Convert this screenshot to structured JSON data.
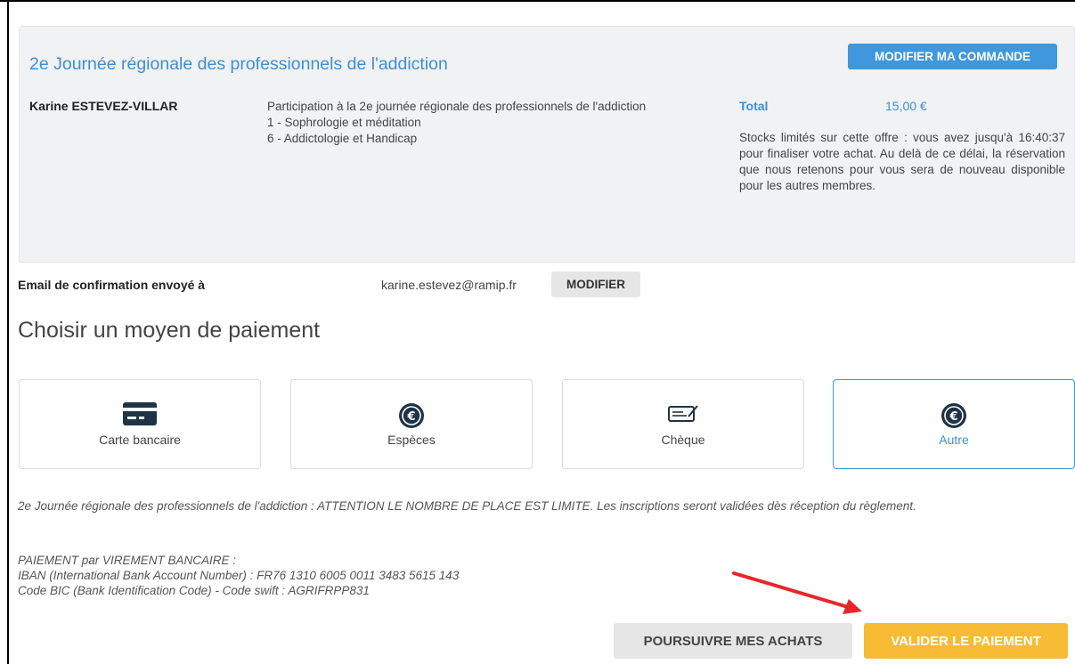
{
  "order": {
    "event_title": "2e Journée régionale des professionnels de l'addiction",
    "modify_button": "MODIFIER MA COMMANDE",
    "customer_name": "Karine ESTEVEZ-VILLAR",
    "item_intro": "Participation à la 2e journée régionale des professionnels de l'addiction",
    "item_options": [
      "1 - Sophrologie et méditation",
      "6 - Addictologie et Handicap"
    ],
    "total_label": "Total",
    "total_value": "15,00 €",
    "stock_notice": "Stocks limités sur cette offre : vous avez jusqu'à 16:40:37 pour finaliser votre achat. Au delà de ce délai, la réservation que nous retenons pour vous sera de nouveau disponible pour les autres membres."
  },
  "confirmation": {
    "label": "Email de confirmation envoyé à",
    "email": "karine.estevez@ramip.fr",
    "modify_button": "MODIFIER"
  },
  "payment": {
    "heading": "Choisir un moyen de paiement",
    "methods": [
      {
        "label": "Carte bancaire",
        "icon": "credit-card-icon",
        "selected": false
      },
      {
        "label": "Espèces",
        "icon": "euro-coin-icon",
        "selected": false
      },
      {
        "label": "Chèque",
        "icon": "cheque-icon",
        "selected": false
      },
      {
        "label": "Autre",
        "icon": "euro-coin-icon",
        "selected": true
      }
    ],
    "notice": "2e Journée régionale des professionnels de l'addiction : ATTENTION LE NOMBRE DE PLACE EST LIMITE. Les inscriptions seront validées dès réception du règlement.",
    "transfer_lines": [
      "PAIEMENT par VIREMENT BANCAIRE :",
      "IBAN (International Bank Account Number) : FR76 1310 6005 0011 3483 5615 143",
      "Code BIC (Bank Identification Code) - Code swift : AGRIFRPP831"
    ]
  },
  "actions": {
    "continue_button": "POURSUIVRE MES ACHATS",
    "validate_button": "VALIDER LE PAIEMENT"
  },
  "colors": {
    "accent_blue": "#3f97dc",
    "validate_yellow": "#f7bc33",
    "annotation_arrow": "#e8262a",
    "summary_background": "#f1f2f4"
  }
}
